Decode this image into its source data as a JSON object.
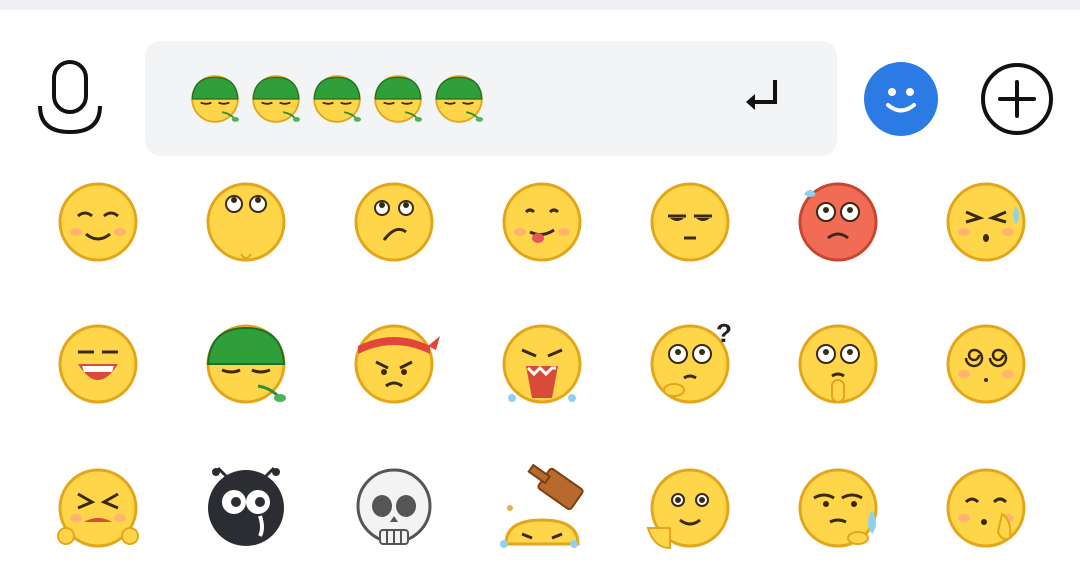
{
  "input": {
    "emojis": [
      "covered-face",
      "covered-face",
      "covered-face",
      "covered-face",
      "covered-face"
    ]
  },
  "toolbar": {
    "left": "microphone-icon",
    "enter": "enter-icon",
    "emoji": "smiley-face-icon",
    "add": "plus-circle-icon"
  },
  "colors": {
    "accent": "#2c7be5",
    "emoji_yellow": "#ffd54a",
    "emoji_outline": "#e3a51a",
    "green_cover": "#2f9f3a",
    "background": "#ffffff",
    "input_bg": "#f3f4f6"
  },
  "emoji_grid": [
    [
      "smile",
      "eyes-up",
      "frown-eyes-up",
      "tongue",
      "meh",
      "shocked-red",
      "sweat-squint"
    ],
    [
      "laugh",
      "covered-face",
      "angry-bandana",
      "scream",
      "question",
      "think",
      "dizzy"
    ],
    [
      "cry-squint",
      "black-face",
      "skull",
      "hammer",
      "blush",
      "side-eye-sweat",
      "shy"
    ]
  ]
}
